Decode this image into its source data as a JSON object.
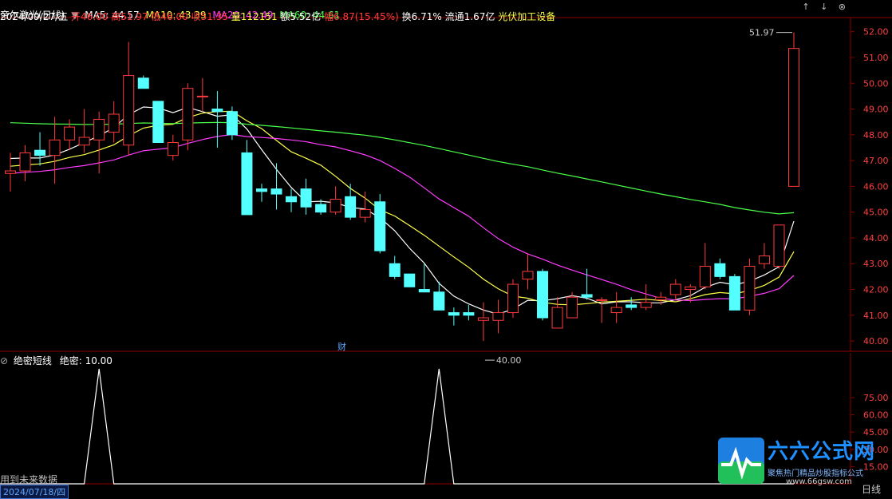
{
  "header": {
    "title": "帝尔激光(日线)",
    "ma5": "MA5: 44.57",
    "ma10": "MA10: 43.39",
    "ma20": "MA20: 42.49",
    "ma60": "MA60: 44.61",
    "date": "2024/09/27/五",
    "open": "开46.00",
    "high": "高51.97",
    "low": "低46.00",
    "close": "收51.35",
    "volume": "量112151",
    "amount": "额5.52亿",
    "change": "幅6.87(15.45%)",
    "turnover": "换6.71%",
    "float": "流通1.67亿",
    "sector": "光伏加工设备"
  },
  "sub_header": {
    "indicator": "绝密短线",
    "value": "绝密: 10.00"
  },
  "top_icons": [
    "↑",
    "↓",
    "⊗"
  ],
  "annotations": {
    "high_label": "51.97",
    "low_label": "40.00",
    "marker": "财"
  },
  "bottom": {
    "left_text": "用到未来数据",
    "date_box": "2024/07/18/四",
    "axis_label": "日线"
  },
  "watermark": {
    "brand": "六六公式网",
    "sub": "聚焦热门精品炒股指标公式",
    "url": "www.66gsw.com"
  },
  "colors": {
    "up": "#ff3b3b",
    "down": "#54ffff",
    "ma5": "#ffffff",
    "ma10": "#ffff4a",
    "ma20": "#ff3dff",
    "ma60": "#4aff4a",
    "grid": "#8b0000",
    "axis_text": "#ff4040"
  },
  "chart_data": [
    {
      "type": "candlestick",
      "title": "帝尔激光(日线)",
      "ylim": [
        39.6,
        52.3
      ],
      "y_ticks": [
        40.0,
        41.0,
        42.0,
        43.0,
        44.0,
        45.0,
        46.0,
        47.0,
        48.0,
        49.0,
        50.0,
        51.0,
        52.0
      ],
      "candles": [
        {
          "o": 46.5,
          "h": 47.3,
          "l": 45.8,
          "c": 46.6
        },
        {
          "o": 46.6,
          "h": 47.6,
          "l": 46.2,
          "c": 47.3
        },
        {
          "o": 47.4,
          "h": 48.1,
          "l": 46.8,
          "c": 47.2
        },
        {
          "o": 47.2,
          "h": 48.7,
          "l": 46.1,
          "c": 47.8
        },
        {
          "o": 47.8,
          "h": 48.6,
          "l": 47.4,
          "c": 48.3
        },
        {
          "o": 47.6,
          "h": 49.0,
          "l": 47.3,
          "c": 47.9
        },
        {
          "o": 47.8,
          "h": 48.9,
          "l": 46.5,
          "c": 48.6
        },
        {
          "o": 48.1,
          "h": 49.3,
          "l": 47.7,
          "c": 48.8
        },
        {
          "o": 47.6,
          "h": 51.6,
          "l": 47.2,
          "c": 50.3
        },
        {
          "o": 50.2,
          "h": 50.3,
          "l": 49.8,
          "c": 49.8
        },
        {
          "o": 49.3,
          "h": 49.3,
          "l": 47.7,
          "c": 47.7
        },
        {
          "o": 47.2,
          "h": 48.0,
          "l": 47.0,
          "c": 47.7
        },
        {
          "o": 47.8,
          "h": 50.0,
          "l": 47.4,
          "c": 49.8
        },
        {
          "o": 49.5,
          "h": 50.2,
          "l": 48.9,
          "c": 49.5
        },
        {
          "o": 49.0,
          "h": 49.7,
          "l": 47.5,
          "c": 48.9
        },
        {
          "o": 48.9,
          "h": 49.1,
          "l": 47.8,
          "c": 48.0
        },
        {
          "o": 47.3,
          "h": 47.8,
          "l": 44.9,
          "c": 44.9
        },
        {
          "o": 45.9,
          "h": 46.1,
          "l": 45.4,
          "c": 45.8
        },
        {
          "o": 45.9,
          "h": 46.9,
          "l": 45.1,
          "c": 45.7
        },
        {
          "o": 45.6,
          "h": 45.9,
          "l": 45.0,
          "c": 45.4
        },
        {
          "o": 45.9,
          "h": 46.3,
          "l": 44.9,
          "c": 45.2
        },
        {
          "o": 45.3,
          "h": 45.5,
          "l": 44.9,
          "c": 45.0
        },
        {
          "o": 45.0,
          "h": 46.0,
          "l": 44.9,
          "c": 45.5
        },
        {
          "o": 45.6,
          "h": 46.1,
          "l": 44.7,
          "c": 44.8
        },
        {
          "o": 44.8,
          "h": 45.8,
          "l": 44.6,
          "c": 45.1
        },
        {
          "o": 45.4,
          "h": 45.7,
          "l": 43.4,
          "c": 43.5
        },
        {
          "o": 43.0,
          "h": 43.3,
          "l": 42.4,
          "c": 42.5
        },
        {
          "o": 42.6,
          "h": 42.5,
          "l": 42.1,
          "c": 42.1
        },
        {
          "o": 42.0,
          "h": 43.0,
          "l": 41.9,
          "c": 41.9
        },
        {
          "o": 41.9,
          "h": 42.3,
          "l": 41.2,
          "c": 41.2
        },
        {
          "o": 41.1,
          "h": 41.3,
          "l": 40.6,
          "c": 41.0
        },
        {
          "o": 41.1,
          "h": 41.4,
          "l": 40.8,
          "c": 41.0
        },
        {
          "o": 40.8,
          "h": 41.5,
          "l": 40.0,
          "c": 40.9
        },
        {
          "o": 40.8,
          "h": 41.6,
          "l": 40.3,
          "c": 41.1
        },
        {
          "o": 41.1,
          "h": 42.4,
          "l": 40.9,
          "c": 42.2
        },
        {
          "o": 42.4,
          "h": 43.4,
          "l": 42.0,
          "c": 42.7
        },
        {
          "o": 42.7,
          "h": 42.8,
          "l": 40.8,
          "c": 40.9
        },
        {
          "o": 40.5,
          "h": 41.7,
          "l": 40.5,
          "c": 41.3
        },
        {
          "o": 40.9,
          "h": 41.9,
          "l": 40.9,
          "c": 41.7
        },
        {
          "o": 41.8,
          "h": 42.8,
          "l": 41.6,
          "c": 41.7
        },
        {
          "o": 41.6,
          "h": 41.7,
          "l": 40.7,
          "c": 41.6
        },
        {
          "o": 41.1,
          "h": 41.9,
          "l": 40.7,
          "c": 41.3
        },
        {
          "o": 41.4,
          "h": 41.7,
          "l": 41.2,
          "c": 41.3
        },
        {
          "o": 41.3,
          "h": 42.2,
          "l": 41.2,
          "c": 41.5
        },
        {
          "o": 41.6,
          "h": 41.9,
          "l": 41.4,
          "c": 41.7
        },
        {
          "o": 41.8,
          "h": 42.4,
          "l": 41.6,
          "c": 42.2
        },
        {
          "o": 42.0,
          "h": 42.2,
          "l": 41.5,
          "c": 42.1
        },
        {
          "o": 42.1,
          "h": 43.8,
          "l": 42.0,
          "c": 42.9
        },
        {
          "o": 43.0,
          "h": 43.2,
          "l": 42.4,
          "c": 42.5
        },
        {
          "o": 42.5,
          "h": 42.6,
          "l": 41.2,
          "c": 41.2
        },
        {
          "o": 41.2,
          "h": 43.2,
          "l": 41.0,
          "c": 42.9
        },
        {
          "o": 43.0,
          "h": 43.8,
          "l": 42.8,
          "c": 43.3
        },
        {
          "o": 42.9,
          "h": 44.5,
          "l": 42.8,
          "c": 44.5
        },
        {
          "o": 46.0,
          "h": 51.97,
          "l": 46.0,
          "c": 51.35
        }
      ],
      "ma": [
        {
          "name": "MA5",
          "value": 44.57
        },
        {
          "name": "MA10",
          "value": 43.39
        },
        {
          "name": "MA20",
          "value": 42.49
        },
        {
          "name": "MA60",
          "value": 44.61
        }
      ]
    },
    {
      "type": "line",
      "title": "绝密短线",
      "ylim": [
        0,
        100
      ],
      "y_ticks": [
        75.0,
        60.0,
        45.0,
        30.0,
        15.0
      ],
      "values": [
        0,
        0,
        0,
        0,
        0,
        0,
        100,
        0,
        0,
        0,
        0,
        0,
        0,
        0,
        0,
        0,
        0,
        0,
        0,
        0,
        0,
        0,
        0,
        0,
        0,
        0,
        0,
        0,
        0,
        100,
        0,
        0,
        0,
        0,
        0,
        0,
        0,
        0,
        0,
        0,
        0,
        0,
        0,
        0,
        0,
        0,
        0,
        0,
        0,
        0,
        0,
        0,
        0,
        0
      ]
    }
  ]
}
